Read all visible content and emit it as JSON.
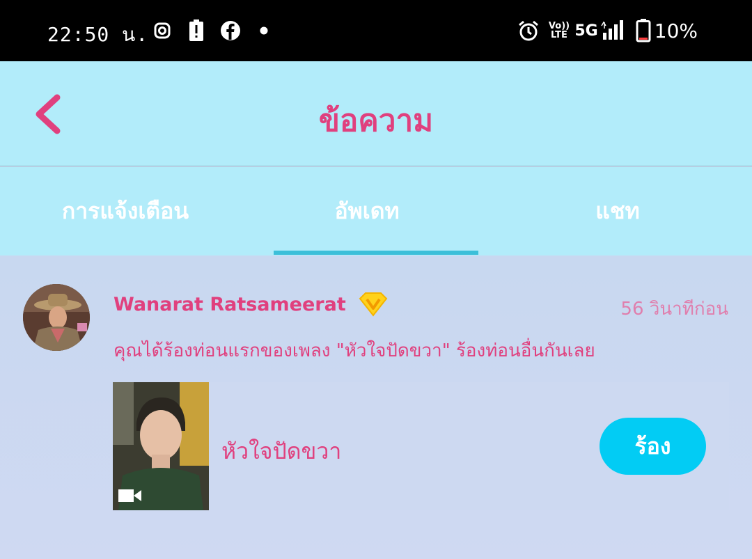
{
  "status_bar": {
    "time": "22:50 น.",
    "battery_percent": "10%",
    "icons_left": [
      "instagram-icon",
      "battery-alert-icon",
      "facebook-icon",
      "dot-icon"
    ],
    "icons_right": [
      "alarm-icon",
      "volte-icon",
      "5g-icon",
      "signal-icon",
      "battery-icon"
    ],
    "network_label": "5G",
    "volte_label_top": "Vo))",
    "volte_label_bottom": "LTE"
  },
  "header": {
    "title": "ข้อความ"
  },
  "tabs": [
    {
      "label": "การแจ้งเตือน",
      "active": false
    },
    {
      "label": "อัพเดท",
      "active": true
    },
    {
      "label": "แชท",
      "active": false
    }
  ],
  "update_item": {
    "username": "Wanarat Ratsameerat",
    "timestamp": "56 วินาทีก่อน",
    "message": "คุณได้ร้องท่อนแรกของเพลง \"หัวใจปัดขวา\" ร้องท่อนอื่นกันเลย",
    "song_title": "หัวใจปัดขวา",
    "sing_button": "ร้อง"
  },
  "colors": {
    "accent_pink": "#e0407e",
    "header_bg": "#b2ecfa",
    "button_blue": "#02ccf4",
    "tab_underline": "#3cbfd9"
  }
}
